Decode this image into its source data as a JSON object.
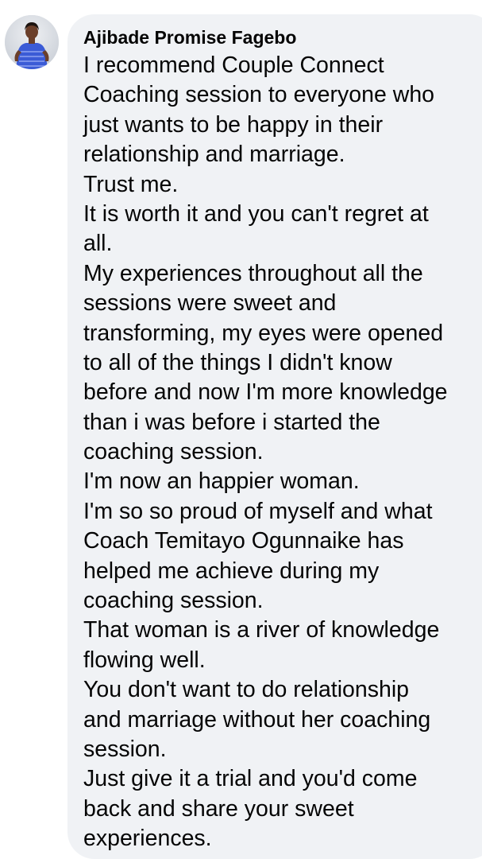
{
  "comment": {
    "author": "Ajibade Promise Fagebo",
    "avatar_icon": "profile-photo",
    "lines": [
      "I recommend Couple Connect",
      "Coaching session to everyone who",
      "just wants to be happy in their",
      "relationship and marriage.",
      "Trust me.",
      "It is worth it and you can't regret at",
      "all.",
      "My experiences throughout all the",
      "sessions were sweet and",
      "transforming, my eyes were opened",
      "to all of the things I didn't know",
      "before and now I'm more knowledge",
      "than i was before i started the",
      "coaching session.",
      "I'm now an happier woman.",
      "I'm so so proud of myself and what",
      "Coach Temitayo Ogunnaike has",
      "helped me achieve during my",
      "coaching session.",
      "That woman is a river of knowledge",
      "flowing well.",
      "You don't want to do relationship",
      "and marriage without her coaching",
      "session.",
      "Just give it a trial and you'd come",
      "back and share your sweet",
      "experiences."
    ]
  },
  "colors": {
    "bubble_background": "#f0f2f5",
    "text": "#050505",
    "avatar_dress": "#3b5bd6"
  }
}
